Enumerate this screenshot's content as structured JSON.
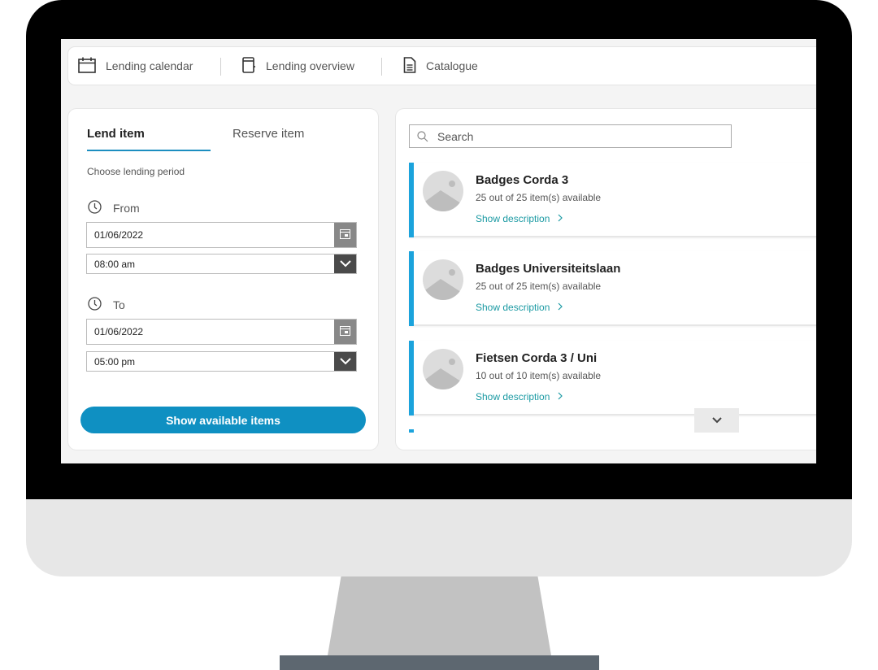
{
  "nav": {
    "items": [
      {
        "label": "Lending calendar",
        "icon": "calendar-icon"
      },
      {
        "label": "Lending overview",
        "icon": "notebook-icon"
      },
      {
        "label": "Catalogue",
        "icon": "document-icon"
      }
    ]
  },
  "lend": {
    "tabs": [
      "Lend item",
      "Reserve item"
    ],
    "period_label": "Choose lending period",
    "from": {
      "label": "From",
      "date": "01/06/2022",
      "time": "08:00 am"
    },
    "to": {
      "label": "To",
      "date": "01/06/2022",
      "time": "05:00 pm"
    },
    "submit_label": "Show available items"
  },
  "catalogue": {
    "search_placeholder": "Search",
    "link_label": "Show description",
    "items": [
      {
        "title": "Badges Corda 3",
        "availability": "25 out of 25 item(s) available"
      },
      {
        "title": "Badges Universiteitslaan",
        "availability": "25 out of 25 item(s) available"
      },
      {
        "title": "Fietsen Corda 3 / Uni",
        "availability": "10 out of 10 item(s) available"
      }
    ]
  },
  "colors": {
    "accent": "#0f90c2",
    "item_bar": "#1ba3dc",
    "link": "#1b9aa3",
    "monitor_frame": "#000000",
    "monitor_chin": "#e7e7e7"
  }
}
